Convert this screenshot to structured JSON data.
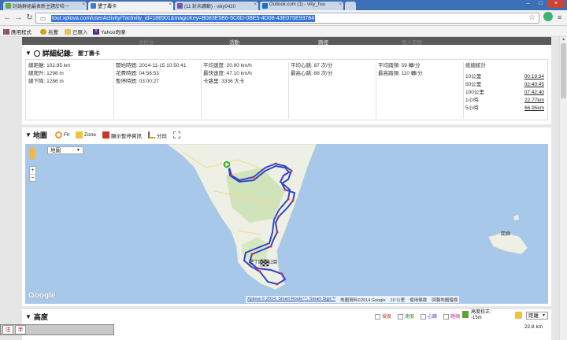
{
  "browser": {
    "tabs": [
      {
        "title": "討論群組最表新主題於哈一"
      },
      {
        "title": "墾丁壽卡"
      },
      {
        "title": "(11 封未讀郵) - viky0420"
      },
      {
        "title": "Outlook.com (1) - viky_hsu"
      }
    ],
    "url": "tour.xplova.com/userActivity/?activity_id=186901&magicKey=B083E5B6-5C6D-0BE5-4D08-43E075E93784",
    "bookmarks": [
      "應用程式",
      "兆豐",
      "已匯入",
      "Yahoo奇摩"
    ]
  },
  "nav": {
    "items": [
      "主控台",
      "活動",
      "路徑",
      "個人空間"
    ]
  },
  "details": {
    "heading": "詳細紀錄:",
    "subtitle": "墾丁壽卡",
    "col1": [
      "總距離: 102.95 km",
      "總爬升: 1298 m",
      "總下降: 1286 m"
    ],
    "col2": [
      "開始時間: 2014-11-15 10:50:41",
      "花費時間: 04:56:53",
      "暫停時間: 03:00:27"
    ],
    "col3": [
      "平均速度: 20.90 km/h",
      "最快速度: 47.10 km/h",
      "卡路里: 3336 大卡"
    ],
    "col4": [
      "平均心跳: 87 次/分",
      "最高心跳: 88 次/分"
    ],
    "col5": [
      "平均踏頻: 59 轉/分",
      "最高踏頻: 110 轉/分"
    ],
    "segment_title": "紙總統計",
    "segments": [
      {
        "label": "10公里",
        "value": "00:19:34"
      },
      {
        "label": "50公里",
        "value": "02:40:45"
      },
      {
        "label": "100公里",
        "value": "07:42:40"
      },
      {
        "label": "1小時",
        "value": "22.77km"
      },
      {
        "label": "5小時",
        "value": "66.95km"
      }
    ]
  },
  "map_section": {
    "heading": "地圖",
    "tools": [
      "Fit",
      "Zone",
      "顯示暫停資訊",
      "分段"
    ],
    "map_type": "地圖",
    "place_label": "墾丁國家公園",
    "island_label": "蘭嶼",
    "footer": [
      "Xplova © 2014, Smart-Route™, Smart-Sign™",
      "地圖資料©2014 Google",
      "10 公里",
      "使用條款",
      "回報地圖錯誤"
    ],
    "google": "Google"
  },
  "elevation": {
    "heading": "高度",
    "legend": [
      "坡度",
      "速度",
      "心跳",
      "踏頻"
    ],
    "calib_label": "高度校正:",
    "calib_value": "-15m",
    "select": "距離",
    "value": "22.8 km"
  },
  "ime": [
    "注",
    "半"
  ],
  "colors": {
    "track": "#3346c8",
    "land": "#eef0e5",
    "sea": "#a8c8ea"
  }
}
